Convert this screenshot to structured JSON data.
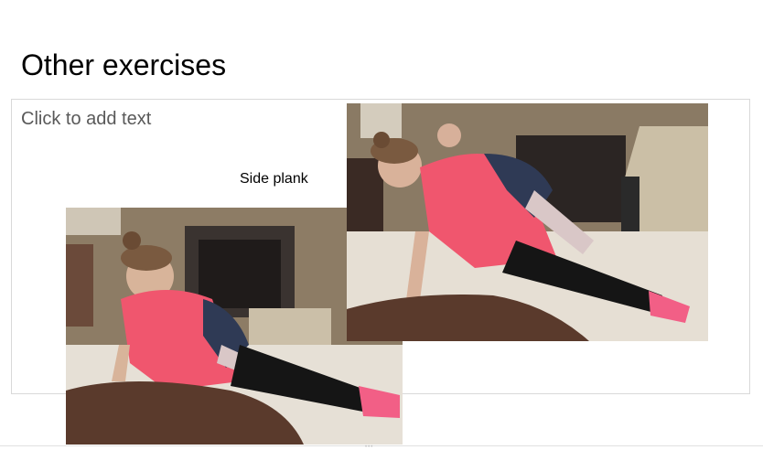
{
  "slide": {
    "title": "Other exercises",
    "body_placeholder": "Click to add text",
    "caption": "Side plank"
  },
  "colors": {
    "shirt": "#f0566e",
    "leggings": "#111111",
    "socks": "#f25f86",
    "pillow": "#5a3a2c",
    "carpet": "#e4ddd2",
    "stone_wall": "#8a7a64"
  }
}
